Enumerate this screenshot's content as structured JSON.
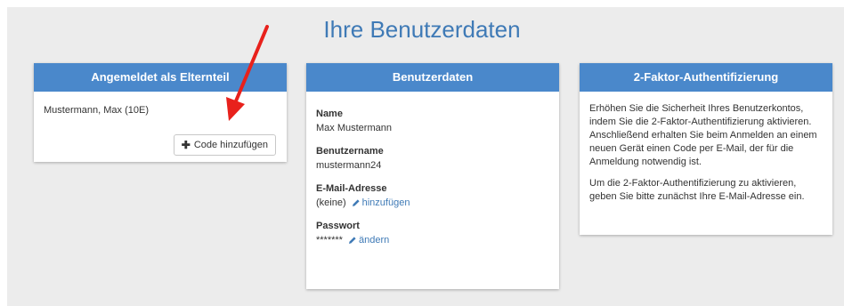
{
  "page": {
    "title": "Ihre Benutzerdaten"
  },
  "parent_card": {
    "header": "Angemeldet als Elternteil",
    "name": "Mustermann, Max (10E)",
    "add_code_label": "Code hinzufügen"
  },
  "user_card": {
    "header": "Benutzerdaten",
    "name_label": "Name",
    "name_value": "Max Mustermann",
    "username_label": "Benutzername",
    "username_value": "mustermann24",
    "email_label": "E-Mail-Adresse",
    "email_value": "(keine)",
    "email_action": "hinzufügen",
    "password_label": "Passwort",
    "password_value": "*******",
    "password_action": "ändern"
  },
  "twofa_card": {
    "header": "2-Faktor-Authentifizierung",
    "paragraph1": "Erhöhen Sie die Sicherheit Ihres Benutzerkontos, indem Sie die 2-Faktor-Authentifizierung aktivieren. Anschließend erhalten Sie beim Anmelden an einem neuen Gerät einen Code per E-Mail, der für die Anmeldung notwendig ist.",
    "paragraph2": "Um die 2-Faktor-Authentifizierung zu aktivieren, geben Sie bitte zunächst Ihre E-Mail-Adresse ein."
  },
  "colors": {
    "header_blue": "#4a88cb",
    "title_blue": "#3f7ab6",
    "link_blue": "#3f7ab6",
    "annotation_arrow": "#e8211c"
  },
  "icons": {
    "add": "plus-icon",
    "edit": "pencil-icon",
    "annotation": "red-arrow-icon"
  }
}
